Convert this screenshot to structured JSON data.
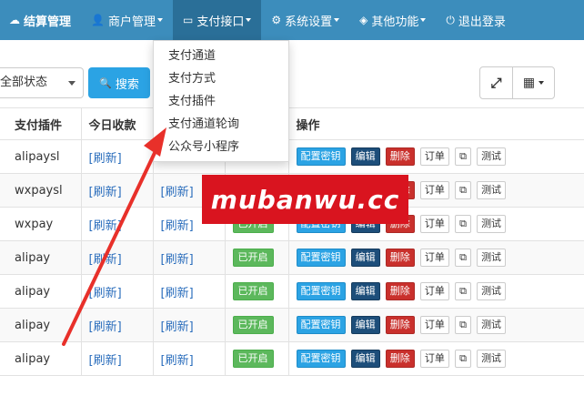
{
  "navbar": {
    "items": [
      {
        "label": "结算管理",
        "icon": "cloud-icon",
        "glyph": "☁"
      },
      {
        "label": "商户管理",
        "icon": "user-icon",
        "glyph": "👤"
      },
      {
        "label": "支付接口",
        "icon": "credit-card-icon",
        "glyph": "▭"
      },
      {
        "label": "系统设置",
        "icon": "gear-icon",
        "glyph": "⚙"
      },
      {
        "label": "其他功能",
        "icon": "cube-icon",
        "glyph": "◈"
      },
      {
        "label": "退出登录",
        "icon": "power-icon",
        "glyph": "⏻"
      }
    ]
  },
  "dropdown": {
    "items": [
      "支付通道",
      "支付方式",
      "支付插件",
      "支付通道轮询",
      "公众号小程序"
    ]
  },
  "filter": {
    "status_select": "全部状态",
    "search_label": "搜索",
    "search_glyph": "🔍",
    "fullscreen_glyph": "⤢",
    "grid_glyph": "▦"
  },
  "table": {
    "headers": [
      "支付插件",
      "今日收款",
      "",
      "",
      "操作"
    ],
    "rows": [
      {
        "plugin": "alipaysl",
        "today": "[刷新]",
        "other": "",
        "status": ""
      },
      {
        "plugin": "wxpaysl",
        "today": "[刷新]",
        "other": "[刷新]",
        "status": ""
      },
      {
        "plugin": "wxpay",
        "today": "[刷新]",
        "other": "[刷新]",
        "status": "已开启"
      },
      {
        "plugin": "alipay",
        "today": "[刷新]",
        "other": "[刷新]",
        "status": "已开启"
      },
      {
        "plugin": "alipay",
        "today": "[刷新]",
        "other": "[刷新]",
        "status": "已开启"
      },
      {
        "plugin": "alipay",
        "today": "[刷新]",
        "other": "[刷新]",
        "status": "已开启"
      },
      {
        "plugin": "alipay",
        "today": "[刷新]",
        "other": "[刷新]",
        "status": "已开启"
      }
    ],
    "actions": {
      "config_key": "配置密钥",
      "edit": "编辑",
      "delete": "删除",
      "orders": "订单",
      "copy_glyph": "⧉",
      "test": "测试"
    }
  },
  "watermark": {
    "text": "mubanwu.cc"
  },
  "colors": {
    "navbar": "#3c8dbc",
    "primary": "#2ba3e4",
    "danger": "#c9302c",
    "success": "#5cb85c",
    "dark": "#1d4e7a",
    "watermark": "#d9141f"
  }
}
